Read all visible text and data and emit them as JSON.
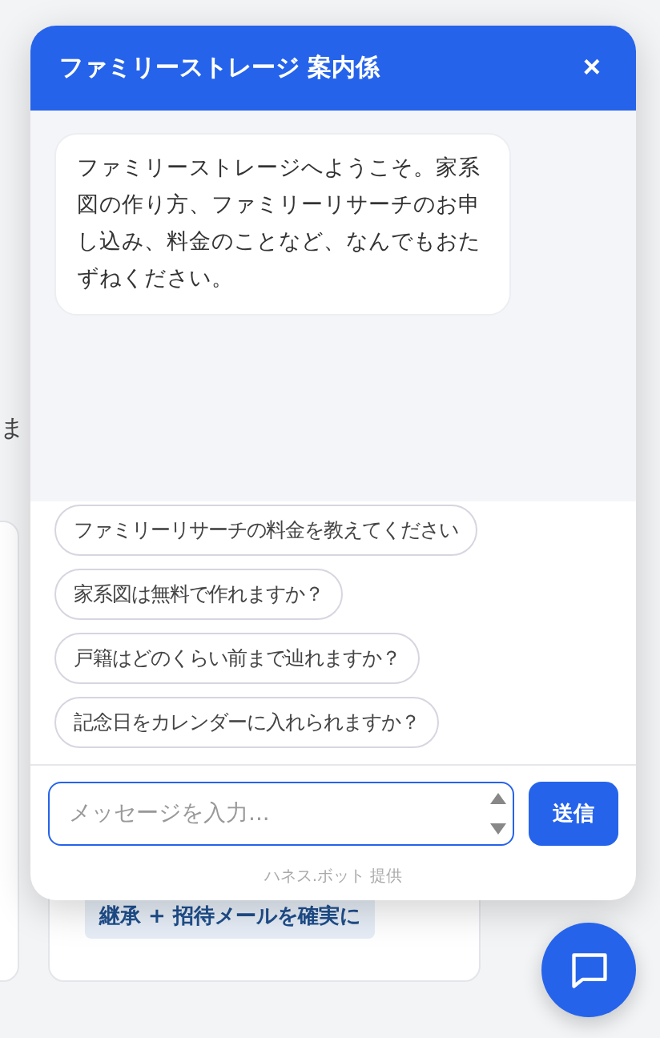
{
  "background": {
    "partial_text": "ま",
    "card_tag": "継承 + 招待メールを確実に"
  },
  "chat": {
    "title": "ファミリーストレージ 案内係",
    "close": "×",
    "messages": [
      {
        "kind": "bot",
        "text": "ファミリーストレージへようこそ。家系図の作り方、ファミリーリサーチのお申し込み、料金のことなど、なんでもおたずねください。"
      }
    ],
    "suggestions": [
      "ファミリーリサーチの料金を教えてください",
      "家系図は無料で作れますか？",
      "戸籍はどのくらい前まで辿れますか？",
      "記念日をカレンダーに入れられますか？"
    ],
    "input": {
      "placeholder": "メッセージを入力..."
    },
    "send": "送信",
    "footer": "ハネス.ボット 提供"
  }
}
